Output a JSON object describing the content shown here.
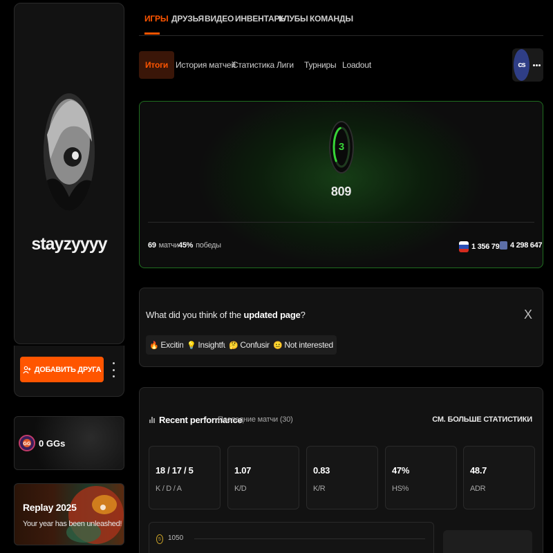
{
  "profile": {
    "username": "stayzyyyy",
    "add_friend_label": "ДОБАВИТЬ ДРУГА"
  },
  "sidebar_cards": {
    "ggs": {
      "label": "0 GGs"
    },
    "replay": {
      "title": "Replay 2025",
      "subtitle": "Your year has been unleashed!"
    }
  },
  "top_nav": {
    "tabs": [
      {
        "label": "ИГРЫ",
        "active": true
      },
      {
        "label": "ДРУЗЬЯ",
        "active": false
      },
      {
        "label": "ВИДЕО",
        "active": false
      },
      {
        "label": "ИНВЕНТАРЬ",
        "active": false
      },
      {
        "label": "КЛУБЫ",
        "active": false
      },
      {
        "label": "КОМАНДЫ",
        "active": false
      }
    ]
  },
  "sub_nav": {
    "tabs": [
      {
        "label": "Итоги",
        "active": true
      },
      {
        "label": "История матчей",
        "active": false
      },
      {
        "label": "Статистика",
        "active": false
      },
      {
        "label": "Лиги",
        "active": false
      },
      {
        "label": "Турниры",
        "active": false
      },
      {
        "label": "Loadout",
        "active": false
      }
    ],
    "game_logo_text": "cs"
  },
  "level_card": {
    "level": "3",
    "level_progress": 0.35,
    "elo": "809",
    "matches_value": "69",
    "matches_label": "матчи",
    "winrate_value": "45%",
    "winrate_label": "победы",
    "country_rank": "1 356 792",
    "world_rank": "4 298 647",
    "accent_color": "#37d437"
  },
  "feedback": {
    "question_prefix": "What did you think of the ",
    "question_bold": "updated page",
    "question_suffix": "?",
    "close_label": "X",
    "options": [
      {
        "emoji": "🔥",
        "label": "Exciting"
      },
      {
        "emoji": "💡",
        "label": "Insightful"
      },
      {
        "emoji": "🤔",
        "label": "Confusing"
      },
      {
        "emoji": "😐",
        "label": "Not interested"
      }
    ]
  },
  "performance": {
    "title": "Recent performance",
    "subtitle": "Последние матчи (30)",
    "more_label": "СМ. БОЛЬШЕ СТАТИСТИКИ",
    "tiles": [
      {
        "value": "18 / 17 / 5",
        "label": "K / D / A"
      },
      {
        "value": "1.07",
        "label": "K/D"
      },
      {
        "value": "0.83",
        "label": "K/R"
      },
      {
        "value": "47%",
        "label": "HS%"
      },
      {
        "value": "48.7",
        "label": "ADR"
      }
    ],
    "graph_badge": "5",
    "graph_value": "1050"
  },
  "colors": {
    "brand_orange": "#ff5500",
    "level_green": "#37d437",
    "background": "#000000",
    "card": "#121212"
  }
}
